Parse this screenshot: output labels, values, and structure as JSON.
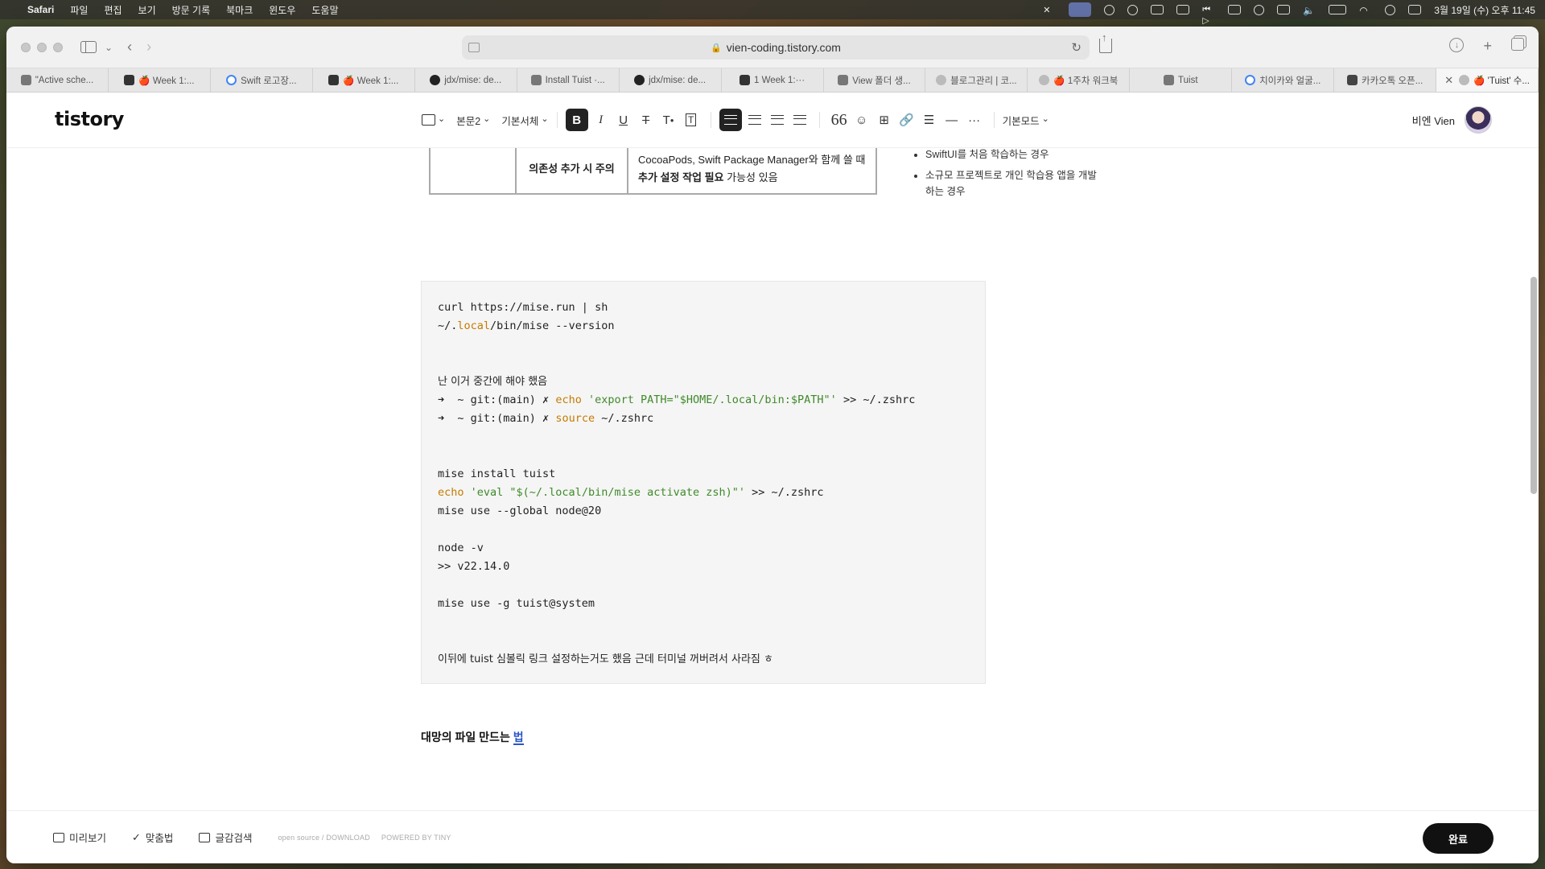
{
  "menubar": {
    "app": "Safari",
    "items": [
      "파일",
      "편집",
      "보기",
      "방문 기록",
      "북마크",
      "윈도우",
      "도움말"
    ],
    "clock": "3월 19일 (수) 오후 11:45"
  },
  "browser": {
    "url": "vien-coding.tistory.com",
    "tabs": [
      {
        "label": "\"Active sche...",
        "icon": "app-icon"
      },
      {
        "label": "🍎 Week 1:...",
        "icon": "notion-icon"
      },
      {
        "label": "Swift 로고장...",
        "icon": "google-icon"
      },
      {
        "label": "🍎 Week 1:...",
        "icon": "notion-icon"
      },
      {
        "label": "jdx/mise: de...",
        "icon": "github-icon"
      },
      {
        "label": "Install Tuist ·...",
        "icon": "app-icon"
      },
      {
        "label": "jdx/mise: de...",
        "icon": "github-icon"
      },
      {
        "label": "1 Week 1:···",
        "icon": "notion-icon"
      },
      {
        "label": "View 폴더 생...",
        "icon": "app-icon"
      },
      {
        "label": "블로그관리 | 코...",
        "icon": "tistory-icon"
      },
      {
        "label": "🍎 1주차 워크북",
        "icon": "tistory-icon"
      },
      {
        "label": "Tuist",
        "icon": "app-icon"
      },
      {
        "label": "치이카와 얼굴...",
        "icon": "google-icon"
      },
      {
        "label": "카카오톡 오픈...",
        "icon": "kakao-icon"
      },
      {
        "label": "🍎 'Tuist' 수...",
        "icon": "tistory-icon"
      }
    ]
  },
  "editor": {
    "logo": "tistory",
    "toolbar": {
      "paragraph": "본문2",
      "font": "기본서체",
      "mode": "기본모드"
    },
    "user": "비엔 Vien"
  },
  "content": {
    "table": {
      "label": "의존성 추가 시 주의",
      "desc_1": "CocoaPods, Swift Package Manager와 함께 쓸 때 ",
      "desc_bold": "추가 설정 작업 필요",
      "desc_2": " 가능성 있음"
    },
    "side_list": [
      "SwiftUI를 처음 학습하는 경우",
      "소규모 프로젝트로 개인 학습용 앱을 개발하는 경우"
    ],
    "code": {
      "l1": "curl https://mise.run | sh",
      "l2a": "~/.",
      "l2b": "local",
      "l2c": "/bin/mise --version",
      "l3": "난 이거 중간에 해야 했음",
      "l4a": "➜  ~ git:(main) ✗ ",
      "l4b": "echo",
      "l4c": " 'export PATH=\"$HOME/.local/bin:$PATH\"'",
      "l4d": " >> ~/.zshrc",
      "l5a": "➜  ~ git:(main) ✗ ",
      "l5b": "source",
      "l5c": " ~/.zshrc",
      "l6": "mise install tuist",
      "l7a": "echo",
      "l7b": " 'eval \"$(~/.local/bin/mise activate zsh)\"'",
      "l7c": " >> ~/.zshrc",
      "l8": "mise use --global node@20",
      "l9": "node -v",
      "l10": ">> v22.14.0",
      "l11": "mise use -g tuist@system",
      "l12": "이뒤에 tuist 심볼릭 링크 설정하는거도 했음 근데 터미널 꺼버려서 사라짐 ㅎ"
    },
    "subheading_main": "대망의 파일 만드는 ",
    "subheading_caret": "법"
  },
  "bottom": {
    "preview": "미리보기",
    "spell": "맞춤법",
    "search": "글감검색",
    "open_source": "open source / DOWNLOAD",
    "powered": "POWERED BY TINY",
    "done": "완료"
  }
}
